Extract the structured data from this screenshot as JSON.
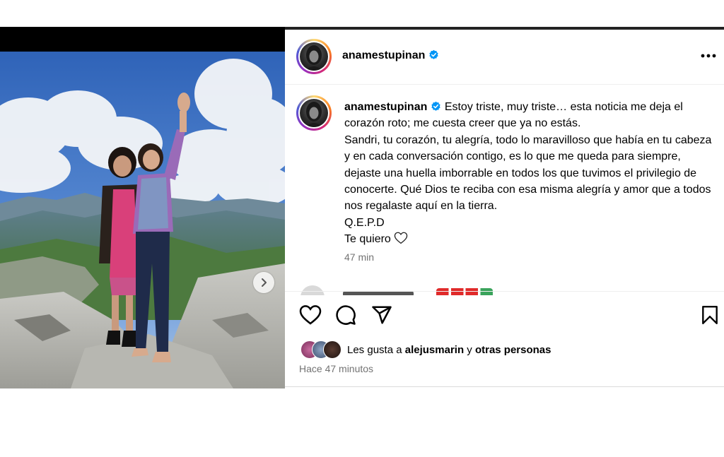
{
  "post": {
    "username": "anamestupinan",
    "caption": {
      "lines": [
        "Estoy triste, muy triste… esta noticia me deja el corazón roto; me cuesta creer que ya no estás.",
        "Sandri, tu corazón, tu alegría, todo lo maravilloso que había en tu cabeza y en cada conversación contigo, es lo que me queda para siempre, dejaste una huella imborrable en todos los que tuvimos el privilegio de conocerte. Qué Dios te reciba con esa misma alegría y amor que a todos nos regalaste aquí en la tierra.",
        "Q.E.P.D",
        "Te quiero"
      ],
      "time": "47 min"
    },
    "likes": {
      "prefix": "Les gusta a",
      "user": "alejusmarin",
      "connector": "y",
      "others": "otras personas"
    },
    "posted_ago": "Hace 47 minutos",
    "icons": {
      "verified": "verified-badge-icon",
      "like": "heart-icon",
      "comment": "comment-icon",
      "share": "send-icon",
      "save": "bookmark-icon",
      "more": "more-options-icon",
      "next": "chevron-right-icon"
    },
    "colors": {
      "verified": "#0095f6",
      "secondary_text": "#737373"
    }
  }
}
